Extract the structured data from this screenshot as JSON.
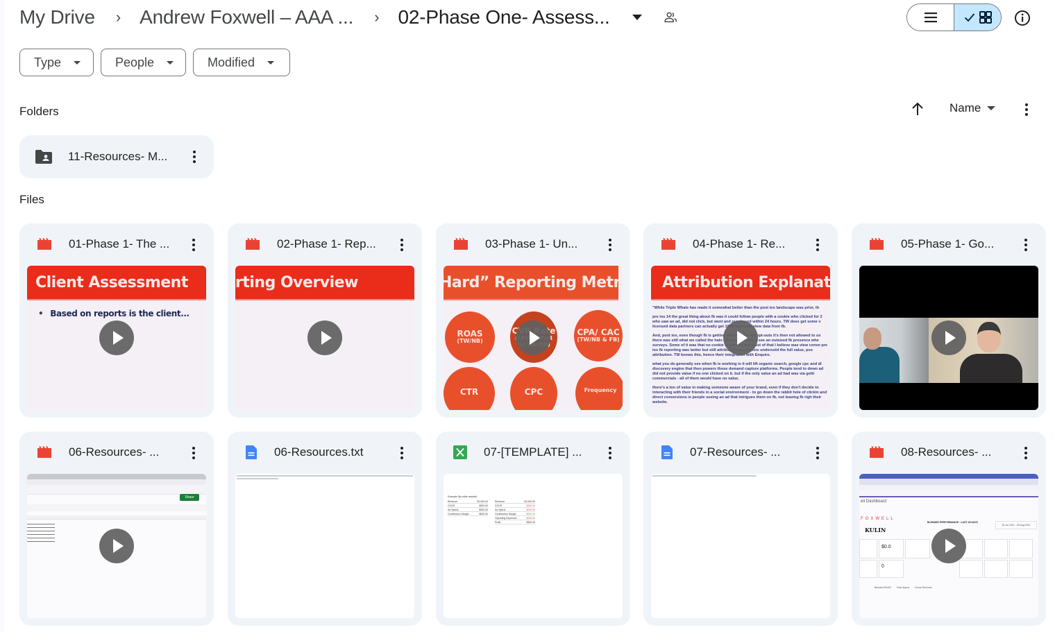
{
  "breadcrumb": {
    "items": [
      "My Drive",
      "Andrew Foxwell – AAA ...",
      "02-Phase One- Assess..."
    ],
    "separator": "›"
  },
  "header": {
    "folder_dropdown_icon": "arrow-drop-down-icon",
    "shared_icon": "shared-people-icon",
    "view_toggle": {
      "options": [
        "list",
        "grid"
      ],
      "selected": "grid"
    },
    "info_icon": "info-icon"
  },
  "filters": [
    {
      "label": "Type"
    },
    {
      "label": "People"
    },
    {
      "label": "Modified"
    }
  ],
  "sections": {
    "folders": "Folders",
    "files": "Files"
  },
  "sort": {
    "direction": "ascending",
    "field": "Name"
  },
  "folders": [
    {
      "name": "11-Resources- M...",
      "icon": "shared-folder-icon"
    }
  ],
  "files": [
    {
      "name": "01-Phase 1- The ...",
      "type": "video",
      "icon": "video-file-icon",
      "thumb": {
        "kind": "slide",
        "title": "Client Assessment",
        "bullet": "Based on reports is the client..."
      }
    },
    {
      "name": "02-Phase 1- Rep...",
      "type": "video",
      "icon": "video-file-icon",
      "thumb": {
        "kind": "slide",
        "title": "rting Overview"
      }
    },
    {
      "name": "03-Phase 1- Un...",
      "type": "video",
      "icon": "video-file-icon",
      "thumb": {
        "kind": "metrics",
        "title": "Hard” Reporting Metric",
        "circles": [
          {
            "label": "ROAS",
            "sub": "(TW/NB)"
          },
          {
            "label": "CVR Rate",
            "sub": "(LPV to PUR %; TW/NB)"
          },
          {
            "label": "CPA/ CAC",
            "sub": "(TW/NB & FB)"
          },
          {
            "label": "CTR",
            "sub": ""
          },
          {
            "label": "CPC",
            "sub": ""
          },
          {
            "label": "Frequency",
            "sub": ""
          }
        ]
      }
    },
    {
      "name": "04-Phase 1- Re...",
      "type": "video",
      "icon": "video-file-icon",
      "thumb": {
        "kind": "text-slide",
        "title": "Attribution Explanati",
        "paragraphs": [
          "\"While Triple Whale has made it somewhat better than the post ios landscape was prior, th",
          "pre ios 14 the great thing about fb was it could follow people with a cookie who clicked for 2 | who saw an ad, did not click, but went and purchased within 24 hours. TW does get some v | licensed data partners can actually get 100% accurate view data from fb.",
          "And, post ios, even though fb is getting that data for ios opt-outs it's then not allowed to us | there was still what we called the halo effect where you'd see an outsized fb presence whe | surveys. Some of it was that no cookie is perfect, but most of that I believe was view conve | pre ios fb reporting was better but still attributed conversions undersold the full value, pos | attribution. TW knows this, hence their integration with Enquire.",
          "what you do generally see when fb is working is it will lift organic search, google cpc and di | discovery engine that then powers those demand capture platforms. People tend to down | ad did not provide value if no one clicked on it. but if the only value an ad had was via getti | commercials - all of them would have no value.",
          "there's a ton of value in making someone aware of your brand, even if they don't decide to | interacting with their friends in a social environment - to go down the rabbit hole of clickin | and direct conversions is people seeing an ad that intrigues them on fb, not leaving fb righ | their website."
        ]
      }
    },
    {
      "name": "05-Phase 1- Go...",
      "type": "video",
      "icon": "video-file-icon",
      "thumb": {
        "kind": "meeting"
      }
    },
    {
      "name": "06-Resources- ...",
      "type": "video",
      "icon": "video-file-icon",
      "thumb": {
        "kind": "spreadsheet-recording",
        "share_label": "Share"
      }
    },
    {
      "name": "06-Resources.txt",
      "type": "text",
      "icon": "docs-file-icon",
      "thumb": {
        "kind": "doc"
      }
    },
    {
      "name": "07-[TEMPLATE] ...",
      "type": "spreadsheet",
      "icon": "excel-file-icon",
      "thumb": {
        "kind": "sheet",
        "caption": "Example (No edits needed)",
        "left_rows": [
          [
            "Revenue",
            "$1,000.00"
          ],
          [
            "COGS",
            "$300.00"
          ],
          [
            "Ad Spend",
            "$200.00"
          ],
          [
            "Contribution Margin",
            "$500.00"
          ]
        ],
        "right_rows": [
          [
            "Revenue",
            "$1,000.00"
          ],
          [
            "COGS",
            "$300.00"
          ],
          [
            "Ad Spend",
            "$200.00"
          ],
          [
            "Contribution Margin",
            "$500.00"
          ],
          [
            "Operating Expenses",
            "$200.00"
          ],
          [
            "Profit",
            "$300.00"
          ]
        ]
      }
    },
    {
      "name": "07-Resources- ...",
      "type": "document",
      "icon": "docs-file-icon",
      "thumb": {
        "kind": "doc"
      }
    },
    {
      "name": "08-Resources- ...",
      "type": "video",
      "icon": "video-file-icon",
      "thumb": {
        "kind": "dashboard-recording",
        "brand": "KULIN",
        "logo": "FOXWELL",
        "heading": "BLENDED PERFORMANCE - LAST 28 DAYS",
        "date_range": "30 Jul 2021 - 28 Aug 2021",
        "dashboard_title": "ell Dashboard",
        "metric_value_1": "$0.0",
        "metric_value_2": "0",
        "legend": [
          "Blended ROAS",
          "Total Spend",
          "Gross Revenue"
        ]
      }
    }
  ],
  "colors": {
    "video_icon": "#ea4335",
    "docs_icon": "#4285f4",
    "sheets_icon": "#34a853",
    "card_bg": "#f0f4f9",
    "view_toggle_selected": "#c2e7ff",
    "slide_red": "#ea2c1b"
  }
}
